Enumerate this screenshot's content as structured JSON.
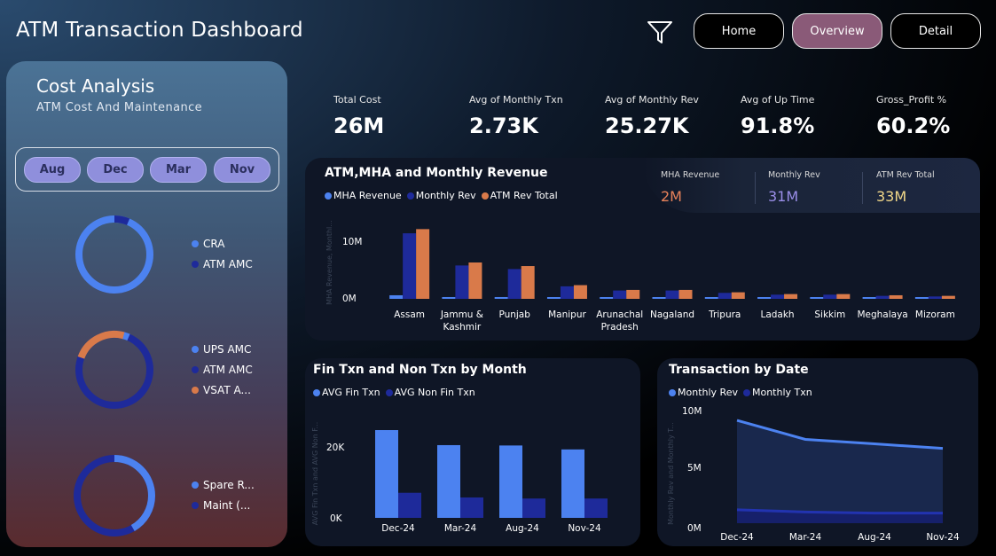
{
  "header": {
    "title": "ATM Transaction Dashboard",
    "nav": {
      "home": "Home",
      "overview": "Overview",
      "detail": "Detail"
    }
  },
  "cost_panel": {
    "title": "Cost Analysis",
    "subtitle": "ATM Cost And Maintenance",
    "months": [
      "Aug",
      "Dec",
      "Mar",
      "Nov"
    ],
    "donuts": [
      {
        "legend": [
          {
            "label": "CRA",
            "color": "#4c82f0"
          },
          {
            "label": "ATM AMC",
            "color": "#1e2a9a"
          }
        ]
      },
      {
        "legend": [
          {
            "label": "UPS AMC",
            "color": "#4c82f0"
          },
          {
            "label": "ATM AMC",
            "color": "#1e2a9a"
          },
          {
            "label": "VSAT A...",
            "color": "#d97a4a"
          }
        ]
      },
      {
        "legend": [
          {
            "label": "Spare R...",
            "color": "#4c82f0"
          },
          {
            "label": "Maint (...",
            "color": "#1e2a9a"
          }
        ]
      }
    ]
  },
  "kpis": [
    {
      "label": "Total Cost",
      "value": "26M"
    },
    {
      "label": "Avg of Monthly Txn",
      "value": "2.73K"
    },
    {
      "label": "Avg of Monthly Rev",
      "value": "25.27K"
    },
    {
      "label": "Avg of Up Time",
      "value": "91.8%"
    },
    {
      "label": "Gross_Profit %",
      "value": "60.2%"
    }
  ],
  "revenue_card": {
    "title": "ATM,MHA and Monthly Revenue",
    "legend": [
      "MHA Revenue",
      "Monthly Rev",
      "ATM Rev Total"
    ],
    "mini_kpis": [
      {
        "label": "MHA Revenue",
        "value": "2M",
        "color": "#e8825a"
      },
      {
        "label": "Monthly Rev",
        "value": "31M",
        "color": "#9a8ee8"
      },
      {
        "label": "ATM Rev Total",
        "value": "33M",
        "color": "#f2d889"
      }
    ],
    "y_ticks": [
      "10M",
      "0M"
    ],
    "y_axis_title": "MHA Revenue, Monthl..."
  },
  "fin_card": {
    "title": "Fin Txn and Non Txn by Month",
    "legend": [
      "AVG Fin Txn",
      "AVG Non Fin Txn"
    ],
    "y_ticks": [
      "20K",
      "0K"
    ],
    "y_axis_title": "AVG Fin Txn and AVG Non F..."
  },
  "date_card": {
    "title": "Transaction by Date",
    "legend": [
      "Monthly Rev",
      "Monthly Txn"
    ],
    "y_ticks": [
      "10M",
      "5M",
      "0M"
    ],
    "y_axis_title": "Monthly Rev and Monthly T..."
  },
  "colors": {
    "light_blue": "#4c82f0",
    "dark_blue": "#1e2a9a",
    "orange": "#d97a4a"
  },
  "chart_data": [
    {
      "type": "bar",
      "title": "ATM,MHA and Monthly Revenue",
      "categories": [
        "Assam",
        "Jammu & Kashmir",
        "Punjab",
        "Manipur",
        "Arunachal Pradesh",
        "Nagaland",
        "Tripura",
        "Ladakh",
        "Sikkim",
        "Meghalaya",
        "Mizoram"
      ],
      "series": [
        {
          "name": "MHA Revenue",
          "values": [
            0.6,
            0.3,
            0.3,
            0.1,
            0.1,
            0.1,
            0.1,
            0.1,
            0.1,
            0.1,
            0.1
          ]
        },
        {
          "name": "Monthly Rev",
          "values": [
            11.0,
            5.6,
            5.0,
            2.1,
            1.4,
            1.4,
            1.0,
            0.7,
            0.7,
            0.5,
            0.4
          ]
        },
        {
          "name": "ATM Rev Total",
          "values": [
            11.7,
            6.1,
            5.5,
            2.3,
            1.5,
            1.5,
            1.1,
            0.8,
            0.8,
            0.6,
            0.5
          ]
        }
      ],
      "ylim": [
        0,
        12.5
      ],
      "unit": "M"
    },
    {
      "type": "bar",
      "title": "Fin Txn and Non Txn by Month",
      "categories": [
        "Dec-24",
        "Mar-24",
        "Aug-24",
        "Nov-24"
      ],
      "series": [
        {
          "name": "AVG Fin Txn",
          "values": [
            24500,
            20300,
            20200,
            19100
          ]
        },
        {
          "name": "AVG Non Fin Txn",
          "values": [
            7000,
            5700,
            5400,
            5400
          ]
        }
      ],
      "ylim": [
        0,
        30000
      ]
    },
    {
      "type": "area",
      "title": "Transaction by Date",
      "categories": [
        "Dec-24",
        "Mar-24",
        "Aug-24",
        "Nov-24"
      ],
      "series": [
        {
          "name": "Monthly Rev",
          "values": [
            9.2,
            7.5,
            7.1,
            6.7
          ]
        },
        {
          "name": "Monthly Txn",
          "values": [
            1.2,
            1.0,
            0.9,
            0.9
          ]
        }
      ],
      "ylim": [
        0,
        10
      ],
      "unit": "M"
    }
  ]
}
